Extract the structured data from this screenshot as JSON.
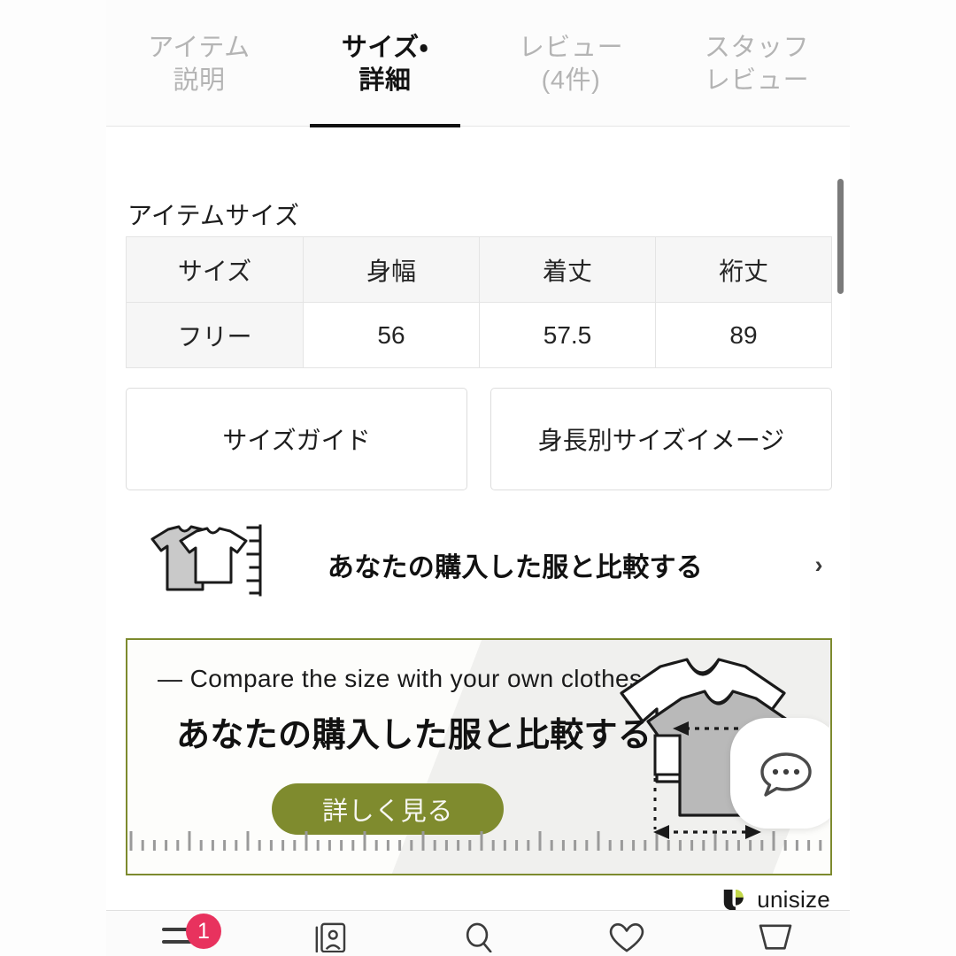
{
  "tabs": [
    {
      "line1": "アイテム",
      "line2": "説明",
      "active": false,
      "name": "tab-item-description"
    },
    {
      "line1": "サイズ・",
      "line2": "詳細",
      "active": true,
      "name": "tab-size-detail"
    },
    {
      "line1": "レビュー",
      "line2": "(4件)",
      "active": false,
      "name": "tab-reviews"
    },
    {
      "line1": "スタッフ",
      "line2": "レビュー",
      "active": false,
      "name": "tab-staff-reviews"
    }
  ],
  "section": {
    "title": "アイテムサイズ"
  },
  "size_table": {
    "headers": [
      "サイズ",
      "身幅",
      "着丈",
      "裄丈"
    ],
    "rows": [
      [
        "フリー",
        "56",
        "57.5",
        "89"
      ]
    ]
  },
  "buttons": {
    "size_guide": "サイズガイド",
    "height_size_image": "身長別サイズイメージ"
  },
  "compare_row": {
    "label": "あなたの購入した服と比較する",
    "chevron": "›",
    "icon": "two-tshirts-ruler-icon"
  },
  "promo": {
    "english_headline": "— Compare the size with your own clothes —",
    "japanese_headline": "あなたの購入した服と比較する",
    "cta_label": "詳しく見る",
    "border_color": "#7d8a2e",
    "cta_color": "#7f8b2e",
    "art": "two-tshirts-measure-illustration",
    "fab_icon": "chat-bubble-icon"
  },
  "unisize": {
    "wordmark": "unisize",
    "mark_dark": "#1a1a1a",
    "mark_green": "#c3d84a"
  },
  "bottom_nav": {
    "items": [
      {
        "name": "nav-menu",
        "icon": "hamburger-menu-icon",
        "badge": "1"
      },
      {
        "name": "nav-account",
        "icon": "account-card-icon",
        "badge": null
      },
      {
        "name": "nav-search",
        "icon": "search-icon",
        "badge": null
      },
      {
        "name": "nav-favorites",
        "icon": "heart-icon",
        "badge": null
      },
      {
        "name": "nav-cart",
        "icon": "shopping-cart-icon",
        "badge": null
      }
    ],
    "badge_color": "#e8325e"
  },
  "scrollbar": {
    "name": "vertical-scrollbar"
  }
}
